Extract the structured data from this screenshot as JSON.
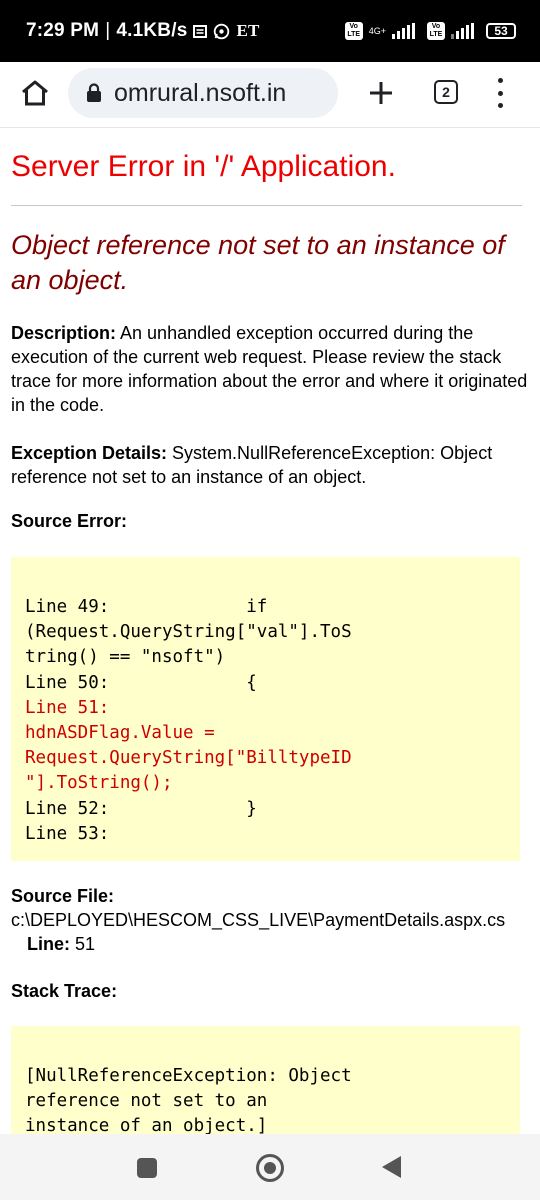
{
  "status_bar": {
    "time": "7:29 PM",
    "speed": "4.1KB/s",
    "notif_et": "ET",
    "volte1": [
      "Vo",
      "LTE"
    ],
    "network1": "4G+",
    "volte2": [
      "Vo",
      "LTE"
    ],
    "battery": "53"
  },
  "browser": {
    "url": "omrural.nsoft.in",
    "tab_count": "2"
  },
  "page": {
    "server_error": "Server Error in '/' Application.",
    "exception_title": "Object reference not set to an instance of an object.",
    "description_label": "Description:",
    "description_text": " An unhandled exception occurred during the execution of the current web request. Please review the stack trace for more information about the error and where it originated in the code.",
    "exception_details_label": "Exception Details:",
    "exception_details_text": " System.NullReferenceException: Object reference not set to an instance of an object.",
    "source_error_label": "Source Error:",
    "source_error_lines": [
      {
        "text": "Line 49:             if",
        "error": false
      },
      {
        "text": "(Request.QueryString[\"val\"].ToS",
        "error": false
      },
      {
        "text": "tring() == \"nsoft\")",
        "error": false
      },
      {
        "text": "Line 50:             {",
        "error": false
      },
      {
        "text": "Line 51:",
        "error": true
      },
      {
        "text": "hdnASDFlag.Value =",
        "error": true
      },
      {
        "text": "Request.QueryString[\"BilltypeID",
        "error": true
      },
      {
        "text": "\"].ToString();",
        "error": true
      },
      {
        "text": "Line 52:             }",
        "error": false
      },
      {
        "text": "Line 53:",
        "error": false
      }
    ],
    "source_file_label": "Source File:",
    "source_file_path": "c:\\DEPLOYED\\HESCOM_CSS_LIVE\\PaymentDetails.aspx.cs",
    "line_label": "Line:",
    "line_value": " 51",
    "stack_trace_label": "Stack Trace:",
    "stack_trace_lines": [
      "[NullReferenceException: Object",
      "reference not set to an",
      "instance of an object.]"
    ]
  }
}
